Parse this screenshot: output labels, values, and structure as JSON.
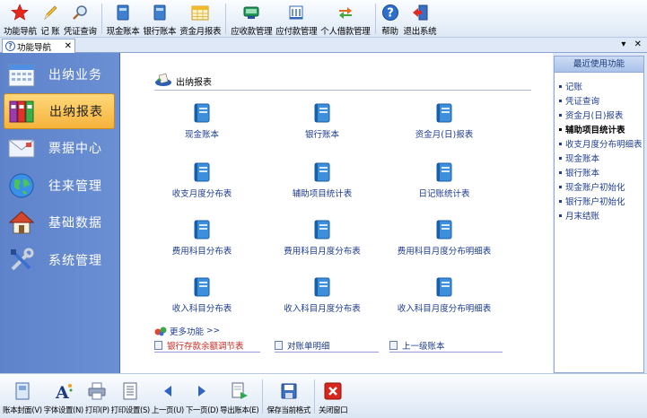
{
  "toolbar": {
    "items": [
      {
        "label": "功能导航",
        "icon": "star-icon"
      },
      {
        "label": "记 账",
        "icon": "pencil-icon"
      },
      {
        "label": "凭证查询",
        "icon": "magnifier-icon"
      },
      {
        "label": "现金账本",
        "icon": "cash-book-icon"
      },
      {
        "label": "银行账本",
        "icon": "bank-book-icon"
      },
      {
        "label": "资金月报表",
        "icon": "calendar-report-icon"
      },
      {
        "label": "应收款管理",
        "icon": "receivable-icon"
      },
      {
        "label": "应付款管理",
        "icon": "payable-icon"
      },
      {
        "label": "个人借款管理",
        "icon": "loan-arrows-icon"
      },
      {
        "label": "帮助",
        "icon": "help-icon"
      },
      {
        "label": "退出系统",
        "icon": "exit-icon"
      }
    ]
  },
  "tab": {
    "label": "功能导航",
    "close": "✕",
    "menu": "▾",
    "close_all": "✕"
  },
  "sidebar": {
    "items": [
      {
        "label": "出纳业务",
        "icon": "calendar-icon"
      },
      {
        "label": "出纳报表",
        "icon": "binders-icon"
      },
      {
        "label": "票据中心",
        "icon": "envelope-icon"
      },
      {
        "label": "往来管理",
        "icon": "globe-icon"
      },
      {
        "label": "基础数据",
        "icon": "house-icon"
      },
      {
        "label": "系统管理",
        "icon": "tools-icon"
      }
    ]
  },
  "main": {
    "section_title": "出纳报表",
    "reports": [
      "现金账本",
      "银行账本",
      "资金月(日)报表",
      "收支月度分布表",
      "辅助项目统计表",
      "日记账统计表",
      "费用科目分布表",
      "费用科目月度分布表",
      "费用科目月度分布明细表",
      "收入科目分布表",
      "收入科目月度分布表",
      "收入科目月度分布明细表"
    ],
    "more_label": "更多功能",
    "more_arrow": ">>",
    "more_links": [
      "银行存款余额调节表",
      "对账单明细",
      "上一级账本"
    ]
  },
  "recent": {
    "title": "最近使用功能",
    "items": [
      "记账",
      "凭证查询",
      "资金月(日)报表",
      "辅助项目统计表",
      "收支月度分布明细表",
      "现金账本",
      "银行账本",
      "现金账户初始化",
      "银行账户初始化",
      "月末结账"
    ]
  },
  "bottombar": {
    "items": [
      {
        "label": "账本封面(V)",
        "icon": "cover-icon"
      },
      {
        "label": "字体设置(N)",
        "icon": "font-icon"
      },
      {
        "label": "打印(P)",
        "icon": "printer-icon"
      },
      {
        "label": "打印设置(S)",
        "icon": "print-settings-icon"
      },
      {
        "label": "上一页(U)",
        "icon": "prev-page-icon"
      },
      {
        "label": "下一页(D)",
        "icon": "next-page-icon"
      },
      {
        "label": "导出账本(E)",
        "icon": "export-icon"
      },
      {
        "label": "保存当前格式",
        "icon": "save-icon"
      },
      {
        "label": "关闭窗口",
        "icon": "close-window-icon"
      }
    ]
  }
}
